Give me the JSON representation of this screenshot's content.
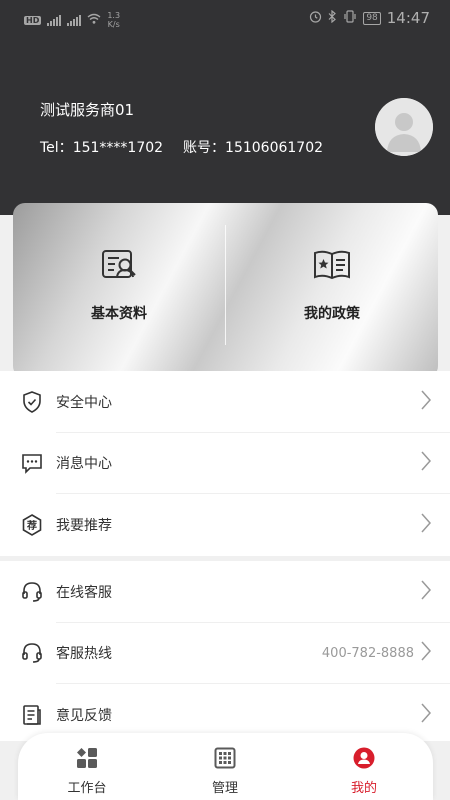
{
  "status_bar": {
    "left_badges": [
      "HD",
      "4G",
      "4G"
    ],
    "speed_value": "1.3",
    "speed_unit": "K/s",
    "battery": "98",
    "time": "14:47"
  },
  "profile": {
    "name": "测试服务商01",
    "tel_label": "Tel：",
    "tel_value": "151****1702",
    "account_label": "账号：",
    "account_value": "15106061702",
    "avatar_icon": "default-avatar-icon"
  },
  "quick_card": {
    "items": [
      {
        "label": "基本资料",
        "icon": "profile-document-icon"
      },
      {
        "label": "我的政策",
        "icon": "policy-book-icon"
      }
    ]
  },
  "menu_group_1": [
    {
      "label": "安全中心",
      "icon": "shield-check-icon"
    },
    {
      "label": "消息中心",
      "icon": "message-bubble-icon"
    },
    {
      "label": "我要推荐",
      "icon": "recommend-badge-icon"
    }
  ],
  "menu_group_2": [
    {
      "label": "在线客服",
      "icon": "headset-icon"
    },
    {
      "label": "客服热线",
      "icon": "headset-icon",
      "value": "400-782-8888"
    },
    {
      "label": "意见反馈",
      "icon": "feedback-note-icon"
    }
  ],
  "tabbar": {
    "tabs": [
      {
        "label": "工作台",
        "icon": "dashboard-grid-icon",
        "active": false
      },
      {
        "label": "管理",
        "icon": "calendar-grid-icon",
        "active": false
      },
      {
        "label": "我的",
        "icon": "user-circle-icon",
        "active": true
      }
    ],
    "active_color": "#d81e2c"
  },
  "colors": {
    "header_bg": "#323234",
    "page_bg": "#f0f0f0",
    "accent": "#d81e2c"
  }
}
